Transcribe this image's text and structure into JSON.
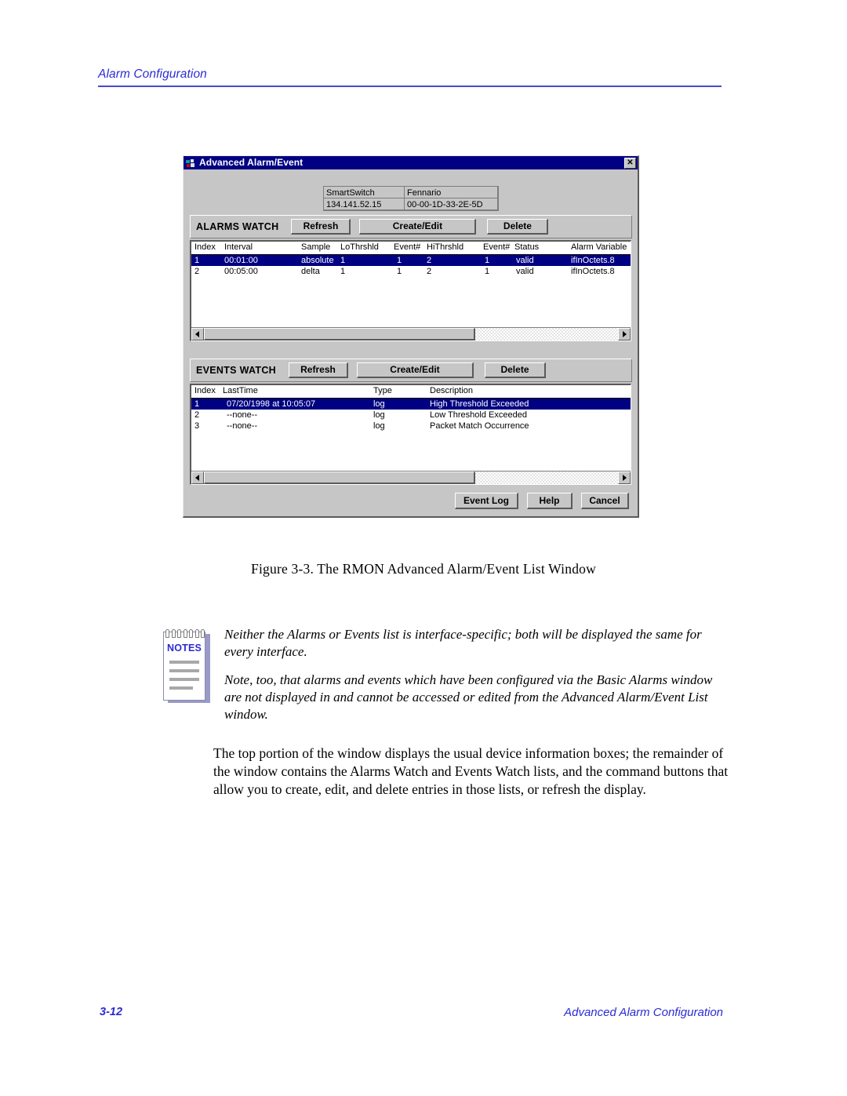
{
  "page": {
    "header_title": "Alarm Configuration",
    "figure_caption": "Figure 3-3.  The RMON Advanced Alarm/Event List Window",
    "footer_left": "3-12",
    "footer_right": "Advanced Alarm Configuration"
  },
  "dialog": {
    "title": "Advanced Alarm/Event",
    "close_label": "✕",
    "device_info": {
      "name": "SmartSwitch",
      "contact": "Fennario",
      "ip_address": "134.141.52.15",
      "mac_address": "00-00-1D-33-2E-5D"
    },
    "alarms": {
      "title": "ALARMS WATCH",
      "refresh_label": "Refresh",
      "create_edit_label": "Create/Edit",
      "delete_label": "Delete",
      "columns": [
        "Index",
        "Interval",
        "Sample",
        "LoThrshld",
        "Event#",
        "HiThrshld",
        "Event#",
        "Status",
        "Alarm Variable"
      ],
      "rows": [
        {
          "index": "1",
          "interval": "00:01:00",
          "sample": "absolute",
          "lo_thrshld": "1",
          "lo_event": "1",
          "hi_thrshld": "2",
          "hi_event": "1",
          "status": "valid",
          "alarm_variable": "ifInOctets.8",
          "selected": true
        },
        {
          "index": "2",
          "interval": "00:05:00",
          "sample": "delta",
          "lo_thrshld": "1",
          "lo_event": "1",
          "hi_thrshld": "2",
          "hi_event": "1",
          "status": "valid",
          "alarm_variable": "ifInOctets.8",
          "selected": false
        }
      ]
    },
    "events": {
      "title": "EVENTS WATCH",
      "refresh_label": "Refresh",
      "create_edit_label": "Create/Edit",
      "delete_label": "Delete",
      "columns": [
        "Index",
        "LastTime",
        "Type",
        "Description"
      ],
      "rows": [
        {
          "index": "1",
          "last_time": "07/20/1998 at 10:05:07",
          "type": "log",
          "description": "High Threshold Exceeded",
          "selected": true
        },
        {
          "index": "2",
          "last_time": "--none--",
          "type": "log",
          "description": "Low Threshold Exceeded",
          "selected": false
        },
        {
          "index": "3",
          "last_time": "--none--",
          "type": "log",
          "description": "Packet Match Occurrence",
          "selected": false
        }
      ]
    },
    "actions": {
      "event_log_label": "Event Log",
      "help_label": "Help",
      "cancel_label": "Cancel"
    }
  },
  "notes": {
    "badge_label": "NOTES",
    "paragraphs": [
      "Neither the Alarms or Events list is interface-specific; both will be displayed the same for every interface.",
      "Note, too, that alarms and events which have been configured via the Basic Alarms window are not displayed in and cannot be accessed or edited from the Advanced Alarm/Event List window."
    ]
  },
  "body": {
    "paragraph": "The top portion of the window displays the usual device information boxes; the remainder of the window contains the Alarms Watch and Events Watch lists, and the command buttons that allow you to create, edit, and delete entries in those lists, or refresh the display."
  },
  "colors": {
    "accent_blue": "#2b2bd4",
    "titlebar_blue": "#000082",
    "dialog_face": "#c6c6c6"
  }
}
